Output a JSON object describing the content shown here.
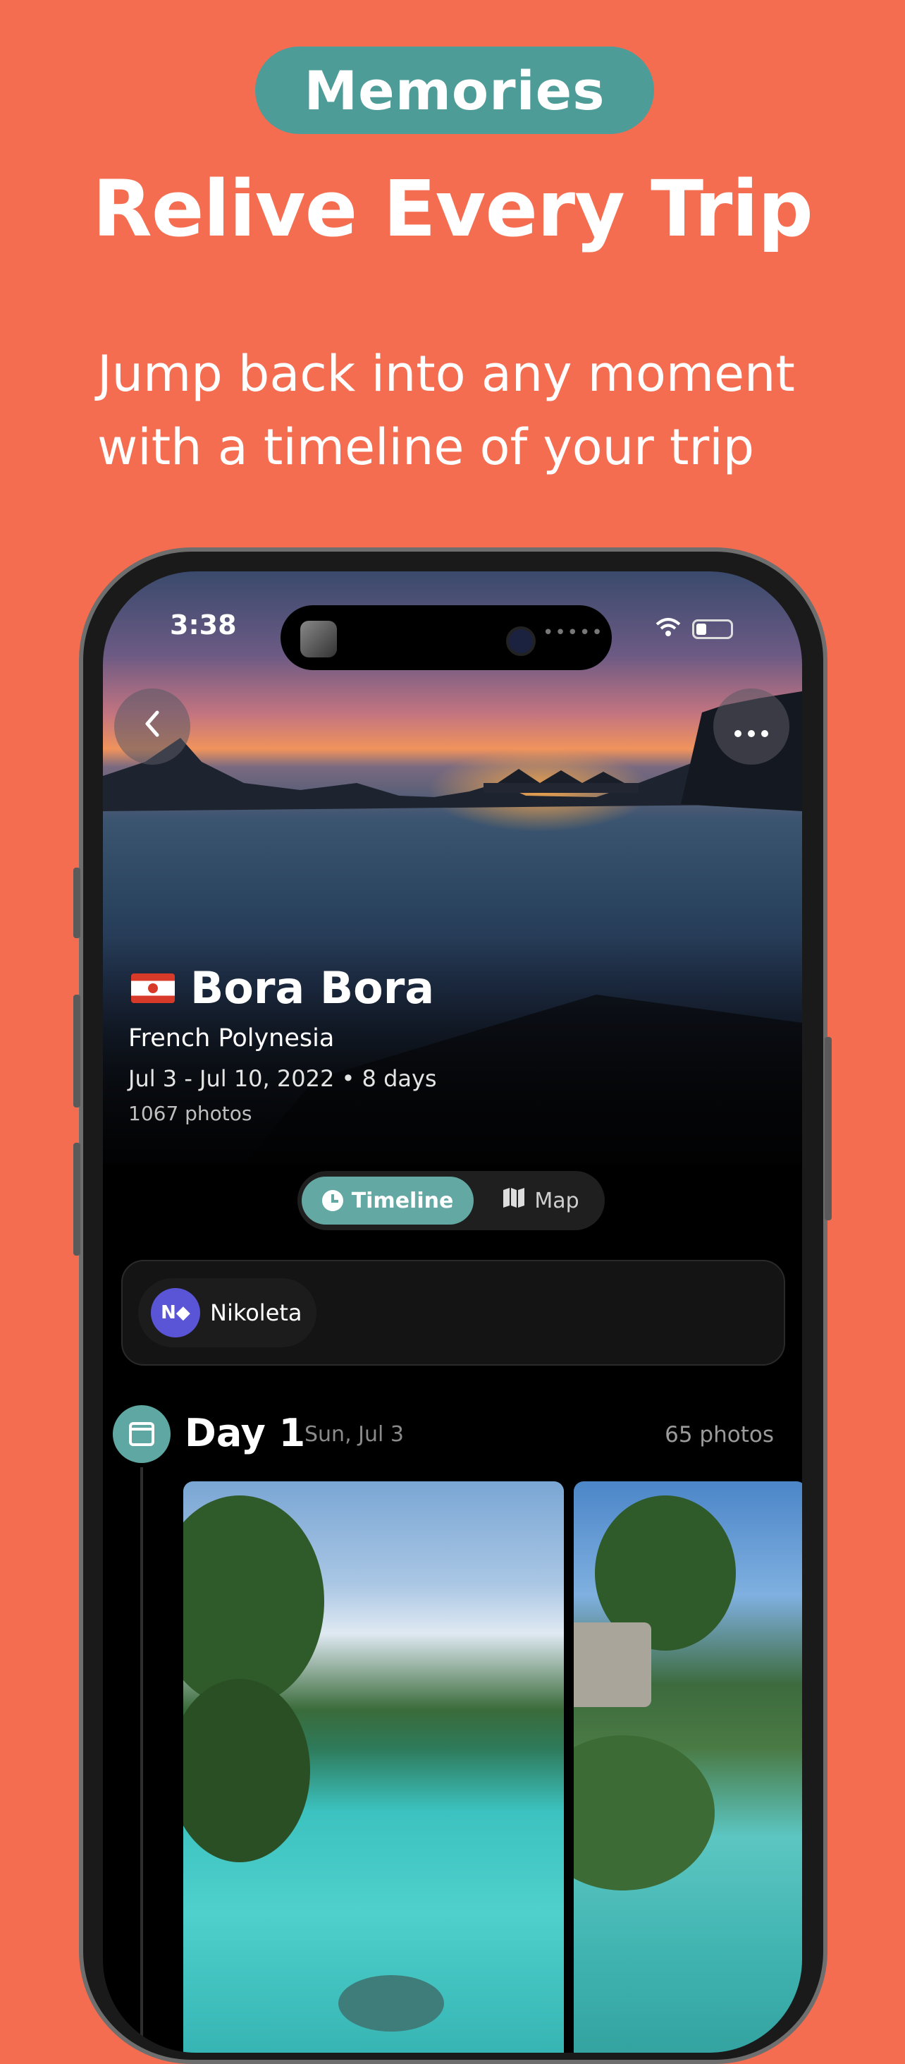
{
  "promo": {
    "badge": "Memories",
    "headline": "Relive Every Trip",
    "subtext": "Jump back into any moment with a timeline of your trip"
  },
  "status_bar": {
    "time": "3:38"
  },
  "trip": {
    "title": "Bora Bora",
    "country": "French Polynesia",
    "dates": "Jul 3 - Jul 10, 2022  •  8 days",
    "photos": "1067 photos"
  },
  "view_toggle": {
    "active": "Timeline",
    "inactive": "Map"
  },
  "people": [
    {
      "initials": "N◆",
      "name": "Nikoleta"
    }
  ],
  "day": {
    "title": "Day 1",
    "date": "Sun, Jul 3",
    "photo_count": "65 photos"
  },
  "icons": {
    "back": "chevron-left-icon",
    "more": "more-horizontal-icon",
    "timeline": "clock-icon",
    "map": "map-icon",
    "calendar": "calendar-icon"
  },
  "colors": {
    "background": "#F56D50",
    "badge": "#4E9C98",
    "accent": "#63A8A3",
    "avatar": "#5A55D6"
  }
}
